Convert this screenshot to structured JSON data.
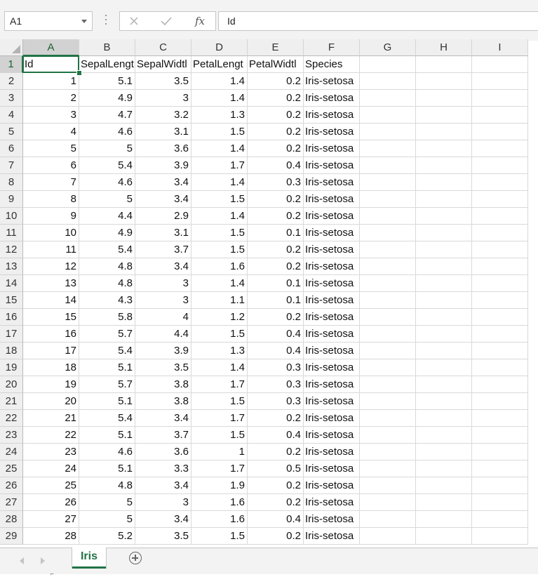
{
  "formula_bar": {
    "name_box": "A1",
    "formula": "Id",
    "fx_label": "fx"
  },
  "columns": [
    "A",
    "B",
    "C",
    "D",
    "E",
    "F",
    "G",
    "H",
    "I"
  ],
  "header_row": [
    "Id",
    "SepalLengt",
    "SepalWidtl",
    "PetalLengt",
    "PetalWidtl",
    "Species"
  ],
  "rows": [
    [
      "1",
      "5.1",
      "3.5",
      "1.4",
      "0.2",
      "Iris-setosa"
    ],
    [
      "2",
      "4.9",
      "3",
      "1.4",
      "0.2",
      "Iris-setosa"
    ],
    [
      "3",
      "4.7",
      "3.2",
      "1.3",
      "0.2",
      "Iris-setosa"
    ],
    [
      "4",
      "4.6",
      "3.1",
      "1.5",
      "0.2",
      "Iris-setosa"
    ],
    [
      "5",
      "5",
      "3.6",
      "1.4",
      "0.2",
      "Iris-setosa"
    ],
    [
      "6",
      "5.4",
      "3.9",
      "1.7",
      "0.4",
      "Iris-setosa"
    ],
    [
      "7",
      "4.6",
      "3.4",
      "1.4",
      "0.3",
      "Iris-setosa"
    ],
    [
      "8",
      "5",
      "3.4",
      "1.5",
      "0.2",
      "Iris-setosa"
    ],
    [
      "9",
      "4.4",
      "2.9",
      "1.4",
      "0.2",
      "Iris-setosa"
    ],
    [
      "10",
      "4.9",
      "3.1",
      "1.5",
      "0.1",
      "Iris-setosa"
    ],
    [
      "11",
      "5.4",
      "3.7",
      "1.5",
      "0.2",
      "Iris-setosa"
    ],
    [
      "12",
      "4.8",
      "3.4",
      "1.6",
      "0.2",
      "Iris-setosa"
    ],
    [
      "13",
      "4.8",
      "3",
      "1.4",
      "0.1",
      "Iris-setosa"
    ],
    [
      "14",
      "4.3",
      "3",
      "1.1",
      "0.1",
      "Iris-setosa"
    ],
    [
      "15",
      "5.8",
      "4",
      "1.2",
      "0.2",
      "Iris-setosa"
    ],
    [
      "16",
      "5.7",
      "4.4",
      "1.5",
      "0.4",
      "Iris-setosa"
    ],
    [
      "17",
      "5.4",
      "3.9",
      "1.3",
      "0.4",
      "Iris-setosa"
    ],
    [
      "18",
      "5.1",
      "3.5",
      "1.4",
      "0.3",
      "Iris-setosa"
    ],
    [
      "19",
      "5.7",
      "3.8",
      "1.7",
      "0.3",
      "Iris-setosa"
    ],
    [
      "20",
      "5.1",
      "3.8",
      "1.5",
      "0.3",
      "Iris-setosa"
    ],
    [
      "21",
      "5.4",
      "3.4",
      "1.7",
      "0.2",
      "Iris-setosa"
    ],
    [
      "22",
      "5.1",
      "3.7",
      "1.5",
      "0.4",
      "Iris-setosa"
    ],
    [
      "23",
      "4.6",
      "3.6",
      "1",
      "0.2",
      "Iris-setosa"
    ],
    [
      "24",
      "5.1",
      "3.3",
      "1.7",
      "0.5",
      "Iris-setosa"
    ],
    [
      "25",
      "4.8",
      "3.4",
      "1.9",
      "0.2",
      "Iris-setosa"
    ],
    [
      "26",
      "5",
      "3",
      "1.6",
      "0.2",
      "Iris-setosa"
    ],
    [
      "27",
      "5",
      "3.4",
      "1.6",
      "0.4",
      "Iris-setosa"
    ],
    [
      "28",
      "5.2",
      "3.5",
      "1.5",
      "0.2",
      "Iris-setosa"
    ]
  ],
  "selected_cell": "A1",
  "sheet_tabs": [
    {
      "label": "Iris",
      "active": true
    }
  ],
  "colors": {
    "accent": "#217346"
  }
}
